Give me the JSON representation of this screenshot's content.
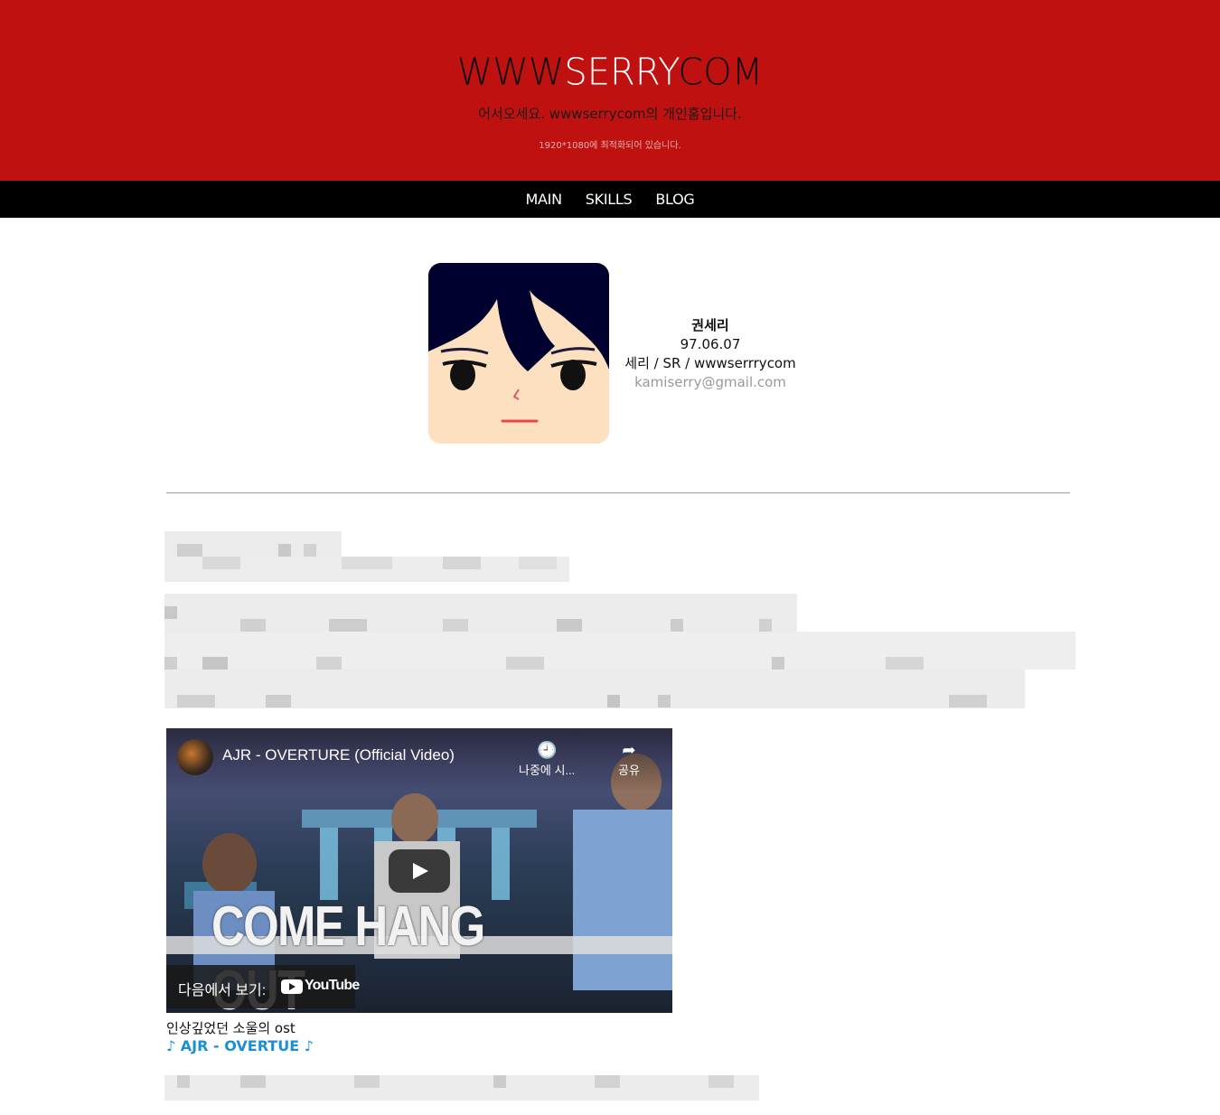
{
  "header": {
    "title_part1": "WWW",
    "title_highlight": "SERRY",
    "title_part2": "COM",
    "welcome": "어서오세요. wwwserrycom의 개인홈입니다.",
    "optimized": "1920*1080에 최적화되어 있습니다."
  },
  "nav": {
    "items": [
      {
        "label": "MAIN"
      },
      {
        "label": "SKILLS"
      },
      {
        "label": "BLOG"
      }
    ]
  },
  "profile": {
    "name": "권세리",
    "birth": "97.06.07",
    "aliases": "세리 / SR / wwwserrrycom",
    "email": "kamiserry@gmail.com"
  },
  "video": {
    "title": "AJR - OVERTURE (Official Video)",
    "watch_later": "나중에 시...",
    "share": "공유",
    "watch_on": "다음에서 보기:",
    "youtube": "YouTube",
    "banner_text": "COME HANG OUT"
  },
  "music": {
    "caption": "인상깊었던 소울의 ost",
    "song": "♪ AJR - OVERTUE ♪"
  },
  "colors": {
    "header_bg": "#c01111",
    "nav_bg": "#000000",
    "link": "#1b8fd6"
  }
}
